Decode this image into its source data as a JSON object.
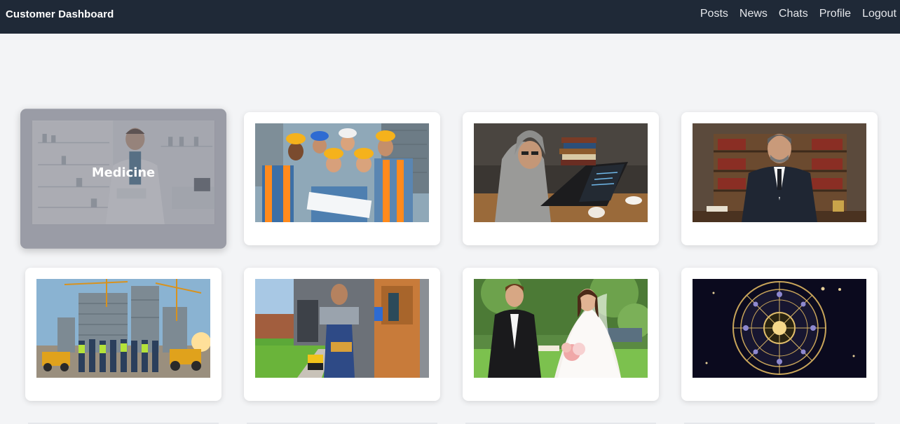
{
  "app": {
    "title": "Customer Dashboard"
  },
  "nav": {
    "items": [
      "Posts",
      "News",
      "Chats",
      "Profile",
      "Logout"
    ]
  },
  "cards": [
    {
      "icon": "medicine-image",
      "label": "Medicine"
    },
    {
      "icon": "construction-team-image"
    },
    {
      "icon": "programmer-image"
    },
    {
      "icon": "lawyer-image"
    },
    {
      "icon": "building-construction-image"
    },
    {
      "icon": "handyman-image"
    },
    {
      "icon": "wedding-image"
    },
    {
      "icon": "astrology-image"
    }
  ]
}
